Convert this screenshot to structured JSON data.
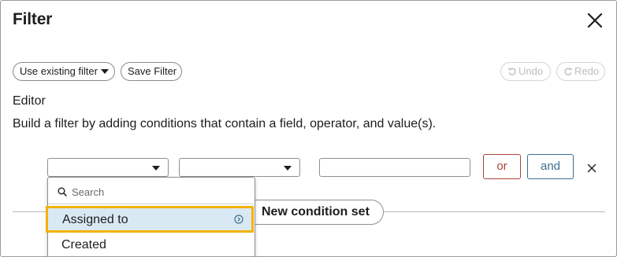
{
  "dialog": {
    "title": "Filter"
  },
  "toolbar": {
    "use_existing_filter_label": "Use existing filter",
    "save_filter_label": "Save Filter",
    "undo_label": "Undo",
    "redo_label": "Redo"
  },
  "editor": {
    "section_label": "Editor",
    "description": "Build a filter by adding conditions that contain a field, operator, and value(s).",
    "condition_row": {
      "field_value": "",
      "operator_value": "",
      "value_text": "",
      "or_label": "or",
      "and_label": "and"
    },
    "new_condition_set_label": "New condition set"
  },
  "field_dropdown": {
    "search_placeholder": "Search",
    "options": [
      {
        "label": "Assigned to",
        "highlighted": true
      },
      {
        "label": "Created",
        "highlighted": false
      }
    ]
  },
  "colors": {
    "or_accent": "#a8423a",
    "and_accent": "#3d6f8d",
    "highlight_border": "#f5b10a",
    "highlight_fill": "#d9e9f3"
  },
  "icons": {
    "close": "close-icon",
    "undo": "undo-icon",
    "redo": "redo-icon",
    "search": "search-icon",
    "chevron": "chevron-right-circle-icon",
    "caret": "caret-down-icon"
  }
}
